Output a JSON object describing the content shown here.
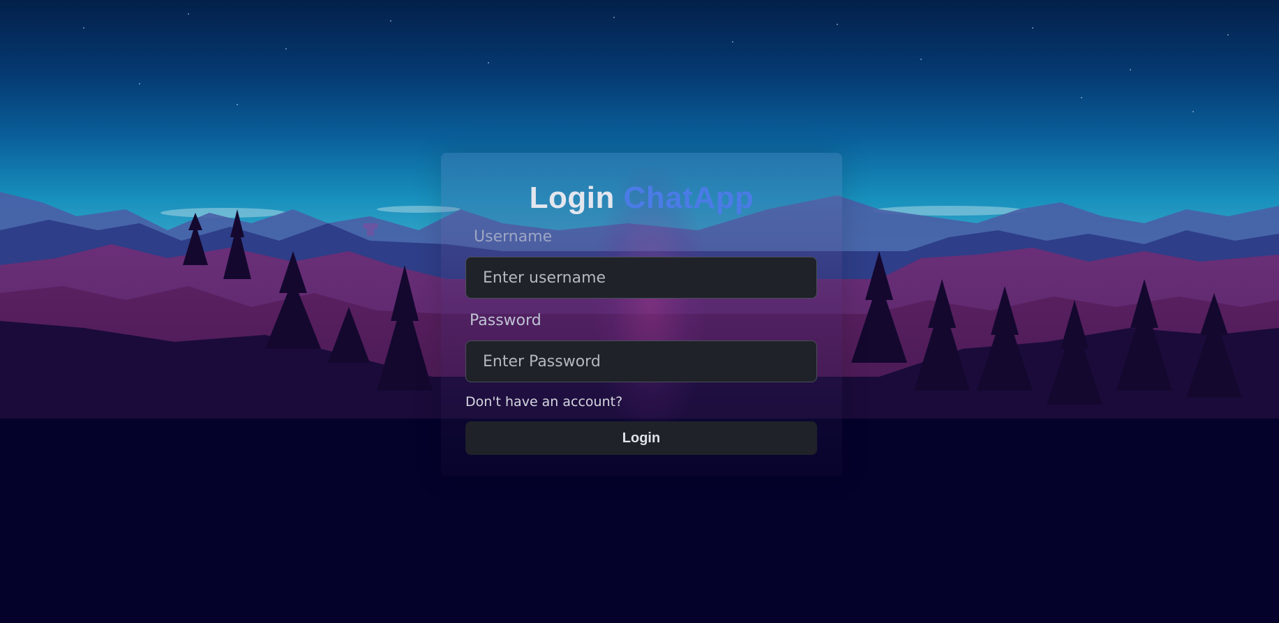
{
  "login_form": {
    "title_prefix": "Login",
    "title_brand": "ChatApp",
    "username_label": "Username",
    "username_placeholder": "Enter username",
    "password_label": "Password",
    "password_placeholder": "Enter Password",
    "signup_prompt": "Don't have an account?",
    "submit_label": "Login"
  },
  "colors": {
    "brand_accent": "#4a7be6",
    "input_background": "#1f2329",
    "sky_top": "#03204a",
    "sky_horizon": "#1890bd",
    "ground": "#04022a"
  }
}
